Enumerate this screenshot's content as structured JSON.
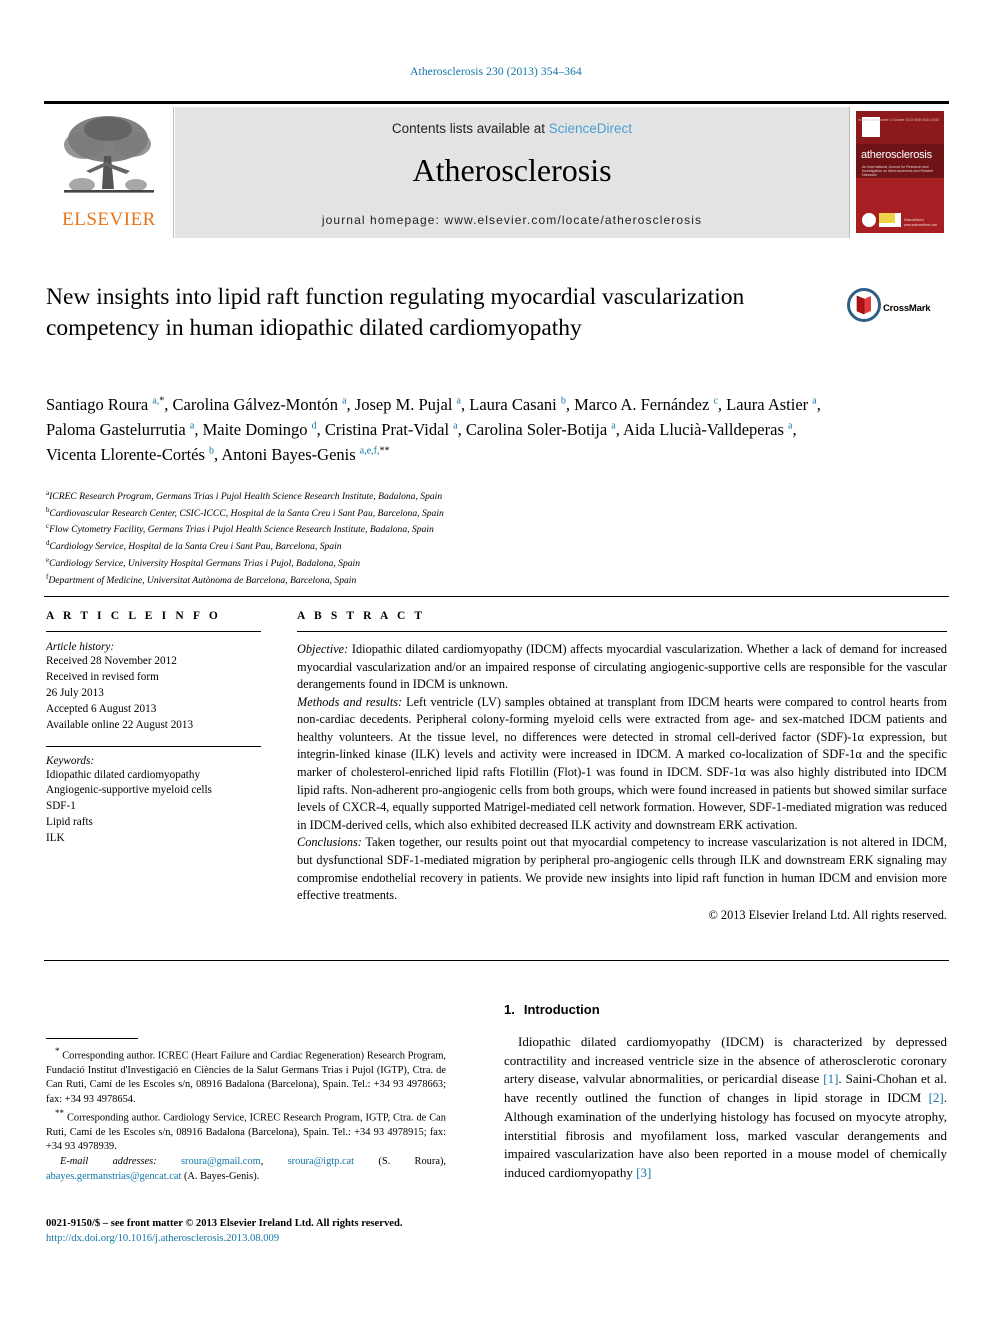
{
  "running_head": "Atherosclerosis 230 (2013) 354–364",
  "masthead": {
    "contents_prefix": "Contents lists available at",
    "sciencedirect": "ScienceDirect",
    "journal_name": "Atherosclerosis",
    "homepage": "journal homepage: www.elsevier.com/locate/atherosclerosis",
    "publisher": "ELSEVIER",
    "cover": {
      "title": "atherosclerosis",
      "subtitle": "An International Journal for Research and Investigation on Atherosclerosis and Related Diseases",
      "header_note": "Volume 230 Number 2   October 2013   ISSN 0021-9150"
    }
  },
  "crossmark": {
    "label": "CrossMark"
  },
  "article": {
    "title": "New insights into lipid raft function regulating myocardial vascularization competency in human idiopathic dilated cardiomyopathy",
    "authors_html": "Santiago Roura <sup>a,</sup><sup class=\"ast\">*</sup>, Carolina Gálvez-Montón <sup>a</sup>, Josep M. Pujal <sup>a</sup>, Laura Casani <sup>b</sup>, Marco A. Fernández <sup>c</sup>, Laura Astier <sup>a</sup>, Paloma Gastelurrutia <sup>a</sup>, Maite Domingo <sup>d</sup>, Cristina Prat-Vidal <sup>a</sup>, Carolina Soler-Botija <sup>a</sup>, Aida Llucià-Valldeperas <sup>a</sup>, Vicenta Llorente-Cortés <sup>b</sup>, Antoni Bayes-Genis <sup>a,e,f,</sup><sup class=\"ast\">**</sup>",
    "affiliations": [
      {
        "mark": "a",
        "text": "ICREC Research Program, Germans Trias i Pujol Health Science Research Institute, Badalona, Spain"
      },
      {
        "mark": "b",
        "text": "Cardiovascular Research Center, CSIC-ICCC, Hospital de la Santa Creu i Sant Pau, Barcelona, Spain"
      },
      {
        "mark": "c",
        "text": "Flow Cytometry Facility, Germans Trias i Pujol Health Science Research Institute, Badalona, Spain"
      },
      {
        "mark": "d",
        "text": "Cardiology Service, Hospital de la Santa Creu i Sant Pau, Barcelona, Spain"
      },
      {
        "mark": "e",
        "text": "Cardiology Service, University Hospital Germans Trias i Pujol, Badalona, Spain"
      },
      {
        "mark": "f",
        "text": "Department of Medicine, Universitat Autònoma de Barcelona, Barcelona, Spain"
      }
    ]
  },
  "article_info": {
    "heading": "A R T I C L E   I N F O",
    "history_title": "Article history:",
    "history": [
      "Received 28 November 2012",
      "Received in revised form",
      "26 July 2013",
      "Accepted 6 August 2013",
      "Available online 22 August 2013"
    ],
    "keywords_title": "Keywords:",
    "keywords": [
      "Idiopathic dilated cardiomyopathy",
      "Angiogenic-supportive myeloid cells",
      "SDF-1",
      "Lipid rafts",
      "ILK"
    ]
  },
  "abstract": {
    "heading": "A B S T R A C T",
    "objective_label": "Objective:",
    "objective_text": " Idiopathic dilated cardiomyopathy (IDCM) affects myocardial vascularization. Whether a lack of demand for increased myocardial vascularization and/or an impaired response of circulating angiogenic-supportive cells are responsible for the vascular derangements found in IDCM is unknown.",
    "methods_label": "Methods and results:",
    "methods_text": " Left ventricle (LV) samples obtained at transplant from IDCM hearts were compared to control hearts from non-cardiac decedents. Peripheral colony-forming myeloid cells were extracted from age- and sex-matched IDCM patients and healthy volunteers. At the tissue level, no differences were detected in stromal cell-derived factor (SDF)-1α expression, but integrin-linked kinase (ILK) levels and activity were increased in IDCM. A marked co-localization of SDF-1α and the specific marker of cholesterol-enriched lipid rafts Flotillin (Flot)-1 was found in IDCM. SDF-1α was also highly distributed into IDCM lipid rafts. Non-adherent pro-angiogenic cells from both groups, which were found increased in patients but showed similar surface levels of CXCR-4, equally supported Matrigel-mediated cell network formation. However, SDF-1-mediated migration was reduced in IDCM-derived cells, which also exhibited decreased ILK activity and downstream ERK activation.",
    "conclusions_label": "Conclusions:",
    "conclusions_text": " Taken together, our results point out that myocardial competency to increase vascularization is not altered in IDCM, but dysfunctional SDF-1-mediated migration by peripheral pro-angiogenic cells through ILK and downstream ERK signaling may compromise endothelial recovery in patients. We provide new insights into lipid raft function in human IDCM and envision more effective treatments.",
    "copyright": "© 2013 Elsevier Ireland Ltd. All rights reserved."
  },
  "introduction": {
    "number": "1.",
    "heading": "Introduction",
    "paragraph_html": "Idiopathic dilated cardiomyopathy (IDCM) is characterized by depressed contractility and increased ventricle size in the absence of atherosclerotic coronary artery disease, valvular abnormalities, or pericardial disease <span class=\"ref\">[1]</span>. Saini-Chohan et al. have recently outlined the function of changes in lipid storage in IDCM <span class=\"ref\">[2]</span>. Although examination of the underlying histology has focused on myocyte atrophy, interstitial fibrosis and myofilament loss, marked vascular derangements and impaired vascularization have also been reported in a mouse model of chemically induced cardiomyopathy <span class=\"ref\">[3]</span>"
  },
  "footnotes": {
    "first_html": "<sup>*</sup> Corresponding author. ICREC (Heart Failure and Cardiac Regeneration) Research Program, Fundació Institut d'Investigació en Ciències de la Salut Germans Trias i Pujol (IGTP), Ctra. de Can Ruti, Camí de les Escoles s/n, 08916 Badalona (Barcelona), Spain. Tel.: +34 93 4978663; fax: +34 93 4978654.",
    "second_html": "<sup>**</sup> Corresponding author. Cardiology Service, ICREC Research Program, IGTP, Ctra. de Can Ruti, Camí de les Escoles s/n, 08916 Badalona (Barcelona), Spain. Tel.: +34 93 4978915; fax: +34 93 4978939.",
    "email_label": "E-mail addresses:",
    "emails_html": " <span class=\"link\">sroura@gmail.com</span>, <span class=\"link\">sroura@igtp.cat</span> (S. Roura), <span class=\"link\">abayes.germanstrias@gencat.cat</span> (A. Bayes-Genis)."
  },
  "footer": {
    "issn_line": "0021-9150/$ – see front matter © 2013 Elsevier Ireland Ltd. All rights reserved.",
    "doi": "http://dx.doi.org/10.1016/j.atherosclerosis.2013.08.009"
  },
  "colors": {
    "link_blue": "#1176a8",
    "sciencedirect_blue": "#4a9fd4",
    "elsevier_orange": "#e8751a",
    "cover_red": "#a61f23"
  }
}
